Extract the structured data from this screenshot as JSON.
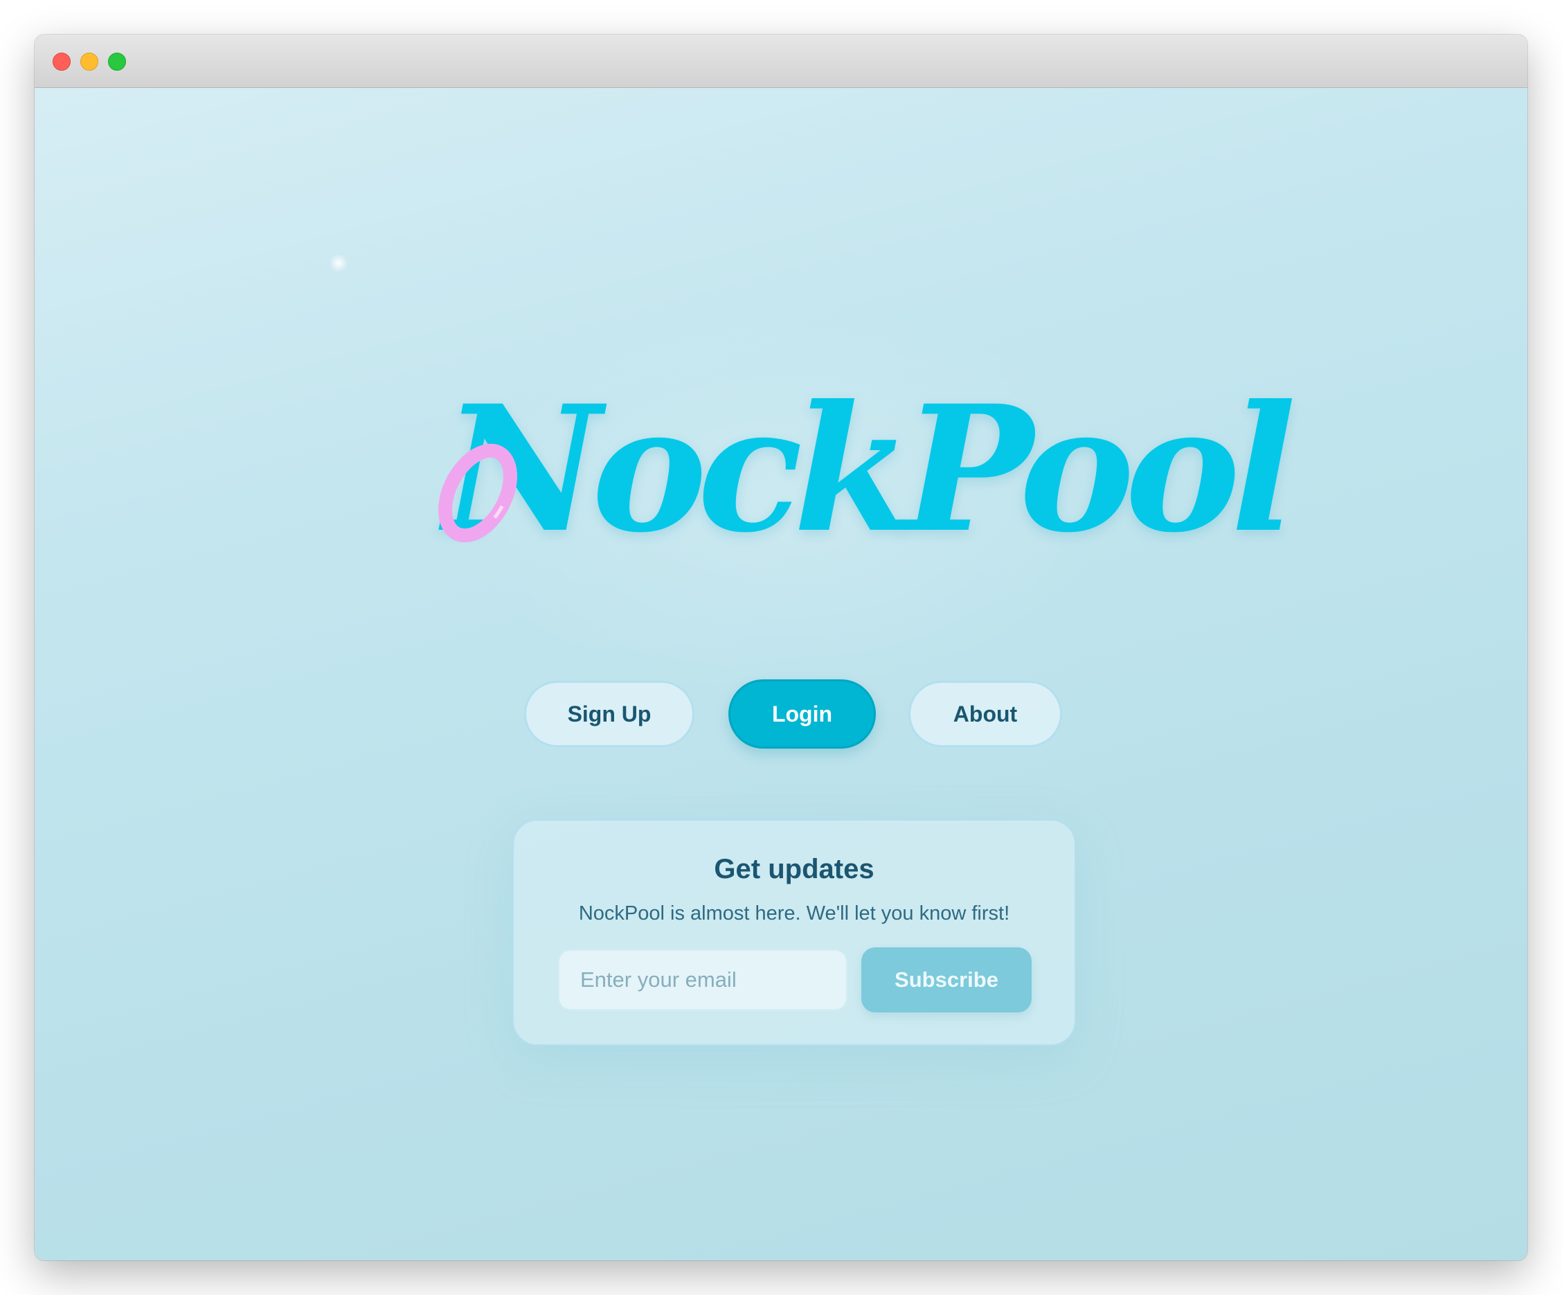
{
  "window": {
    "traffic_lights": [
      "close",
      "minimize",
      "maximize"
    ]
  },
  "logo": {
    "text": "NockPool",
    "color": "#05c8e8",
    "ring_color": "#f0a6ee"
  },
  "nav": {
    "signup_label": "Sign Up",
    "login_label": "Login",
    "about_label": "About"
  },
  "subscribe_card": {
    "title": "Get updates",
    "subtitle": "NockPool is almost here. We'll let you know first!",
    "email_placeholder": "Enter your email",
    "email_value": "",
    "subscribe_label": "Subscribe"
  },
  "colors": {
    "background": "#c4e6ee",
    "primary": "#00b6d2",
    "text_dark": "#1b5570"
  }
}
